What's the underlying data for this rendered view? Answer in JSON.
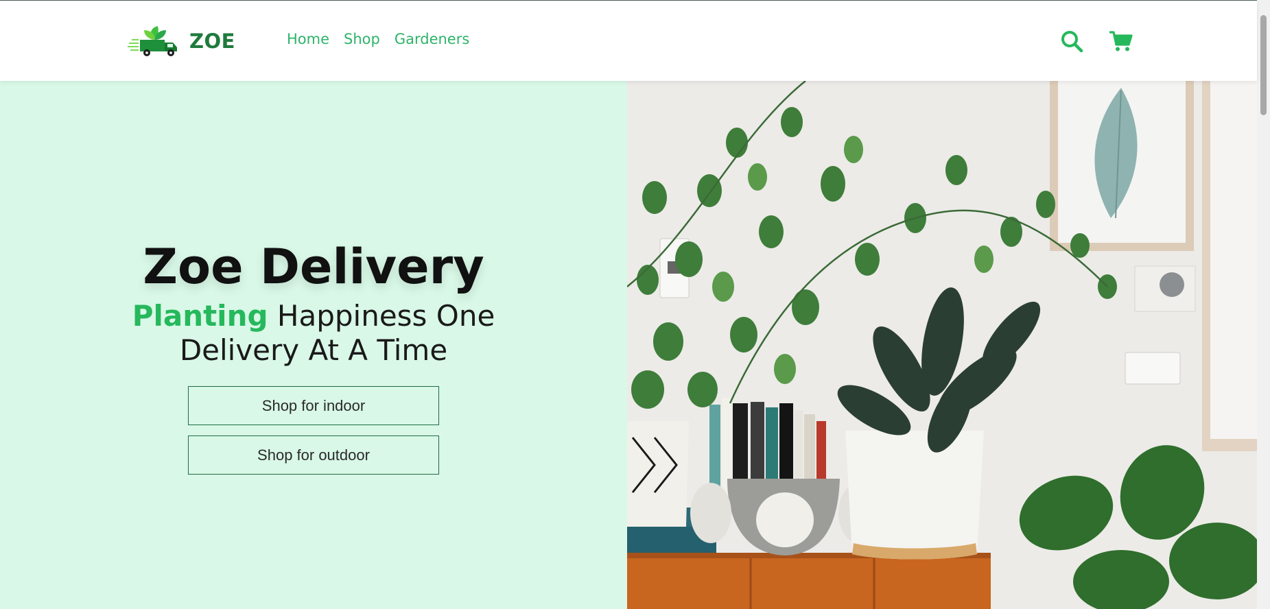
{
  "brand": {
    "name": "ZOE",
    "logo_icon": "delivery-truck-leaf-logo"
  },
  "nav": {
    "links": [
      {
        "label": "Home"
      },
      {
        "label": "Shop"
      },
      {
        "label": "Gardeners"
      }
    ],
    "icons": [
      "search-icon",
      "cart-icon"
    ]
  },
  "hero": {
    "title": "Zoe Delivery",
    "subtitle_accent": "Planting",
    "subtitle_rest": " Happiness One Delivery At A Time",
    "buttons": [
      {
        "label": "Shop for indoor"
      },
      {
        "label": "Shop for outdoor"
      }
    ],
    "image_subject": "indoor plants on a wooden cabinet"
  },
  "colors": {
    "accent": "#26b85c",
    "nav_link": "#2fb36a",
    "brand_text": "#1f7a3c",
    "hero_bg": "#d9f8e7",
    "button_border": "#1f6b43"
  }
}
